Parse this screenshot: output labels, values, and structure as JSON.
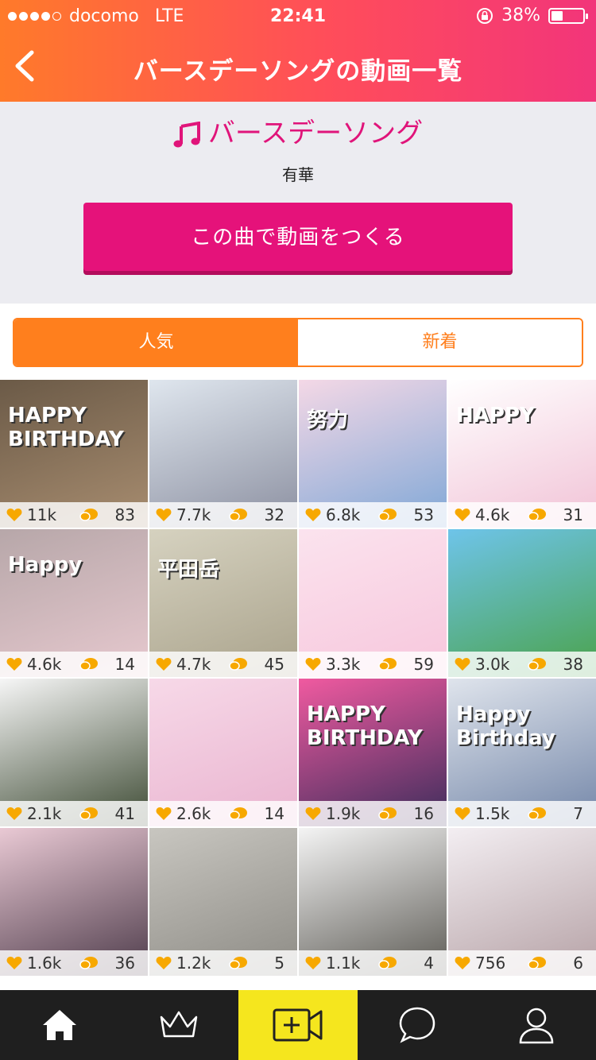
{
  "status_bar": {
    "carrier": "docomo",
    "network": "LTE",
    "time": "22:41",
    "battery": "38%"
  },
  "nav": {
    "title": "バースデーソングの動画一覧",
    "back_icon": "chevron-left-icon"
  },
  "song": {
    "icon": "music-note-icon",
    "title": "バースデーソング",
    "artist": "有華",
    "make_button": "この曲で動画をつくる"
  },
  "segment": {
    "popular": "人気",
    "new": "新着"
  },
  "videos": [
    {
      "likes": "11k",
      "comments": "83",
      "label": "HAPPY BIRTHDAY"
    },
    {
      "likes": "7.7k",
      "comments": "32",
      "label": ""
    },
    {
      "likes": "6.8k",
      "comments": "53",
      "label": "努力"
    },
    {
      "likes": "4.6k",
      "comments": "31",
      "label": "HAPPY"
    },
    {
      "likes": "4.6k",
      "comments": "14",
      "label": "Happy"
    },
    {
      "likes": "4.7k",
      "comments": "45",
      "label": "平田岳"
    },
    {
      "likes": "3.3k",
      "comments": "59",
      "label": ""
    },
    {
      "likes": "3.0k",
      "comments": "38",
      "label": ""
    },
    {
      "likes": "2.1k",
      "comments": "41",
      "label": ""
    },
    {
      "likes": "2.6k",
      "comments": "14",
      "label": ""
    },
    {
      "likes": "1.9k",
      "comments": "16",
      "label": "HAPPY BIRTHDAY"
    },
    {
      "likes": "1.5k",
      "comments": "7",
      "label": "Happy Birthday"
    },
    {
      "likes": "1.6k",
      "comments": "36",
      "label": ""
    },
    {
      "likes": "1.2k",
      "comments": "5",
      "label": ""
    },
    {
      "likes": "1.1k",
      "comments": "4",
      "label": ""
    },
    {
      "likes": "756",
      "comments": "6",
      "label": ""
    }
  ],
  "tabbar": {
    "items": [
      "home-icon",
      "crown-icon",
      "video-add-icon",
      "chat-bubble-icon",
      "profile-icon"
    ],
    "center_color": "#f5e61e"
  },
  "colors": {
    "accent_pink": "#e5127a",
    "accent_orange": "#ff7f1d",
    "heart": "#f7a800"
  }
}
